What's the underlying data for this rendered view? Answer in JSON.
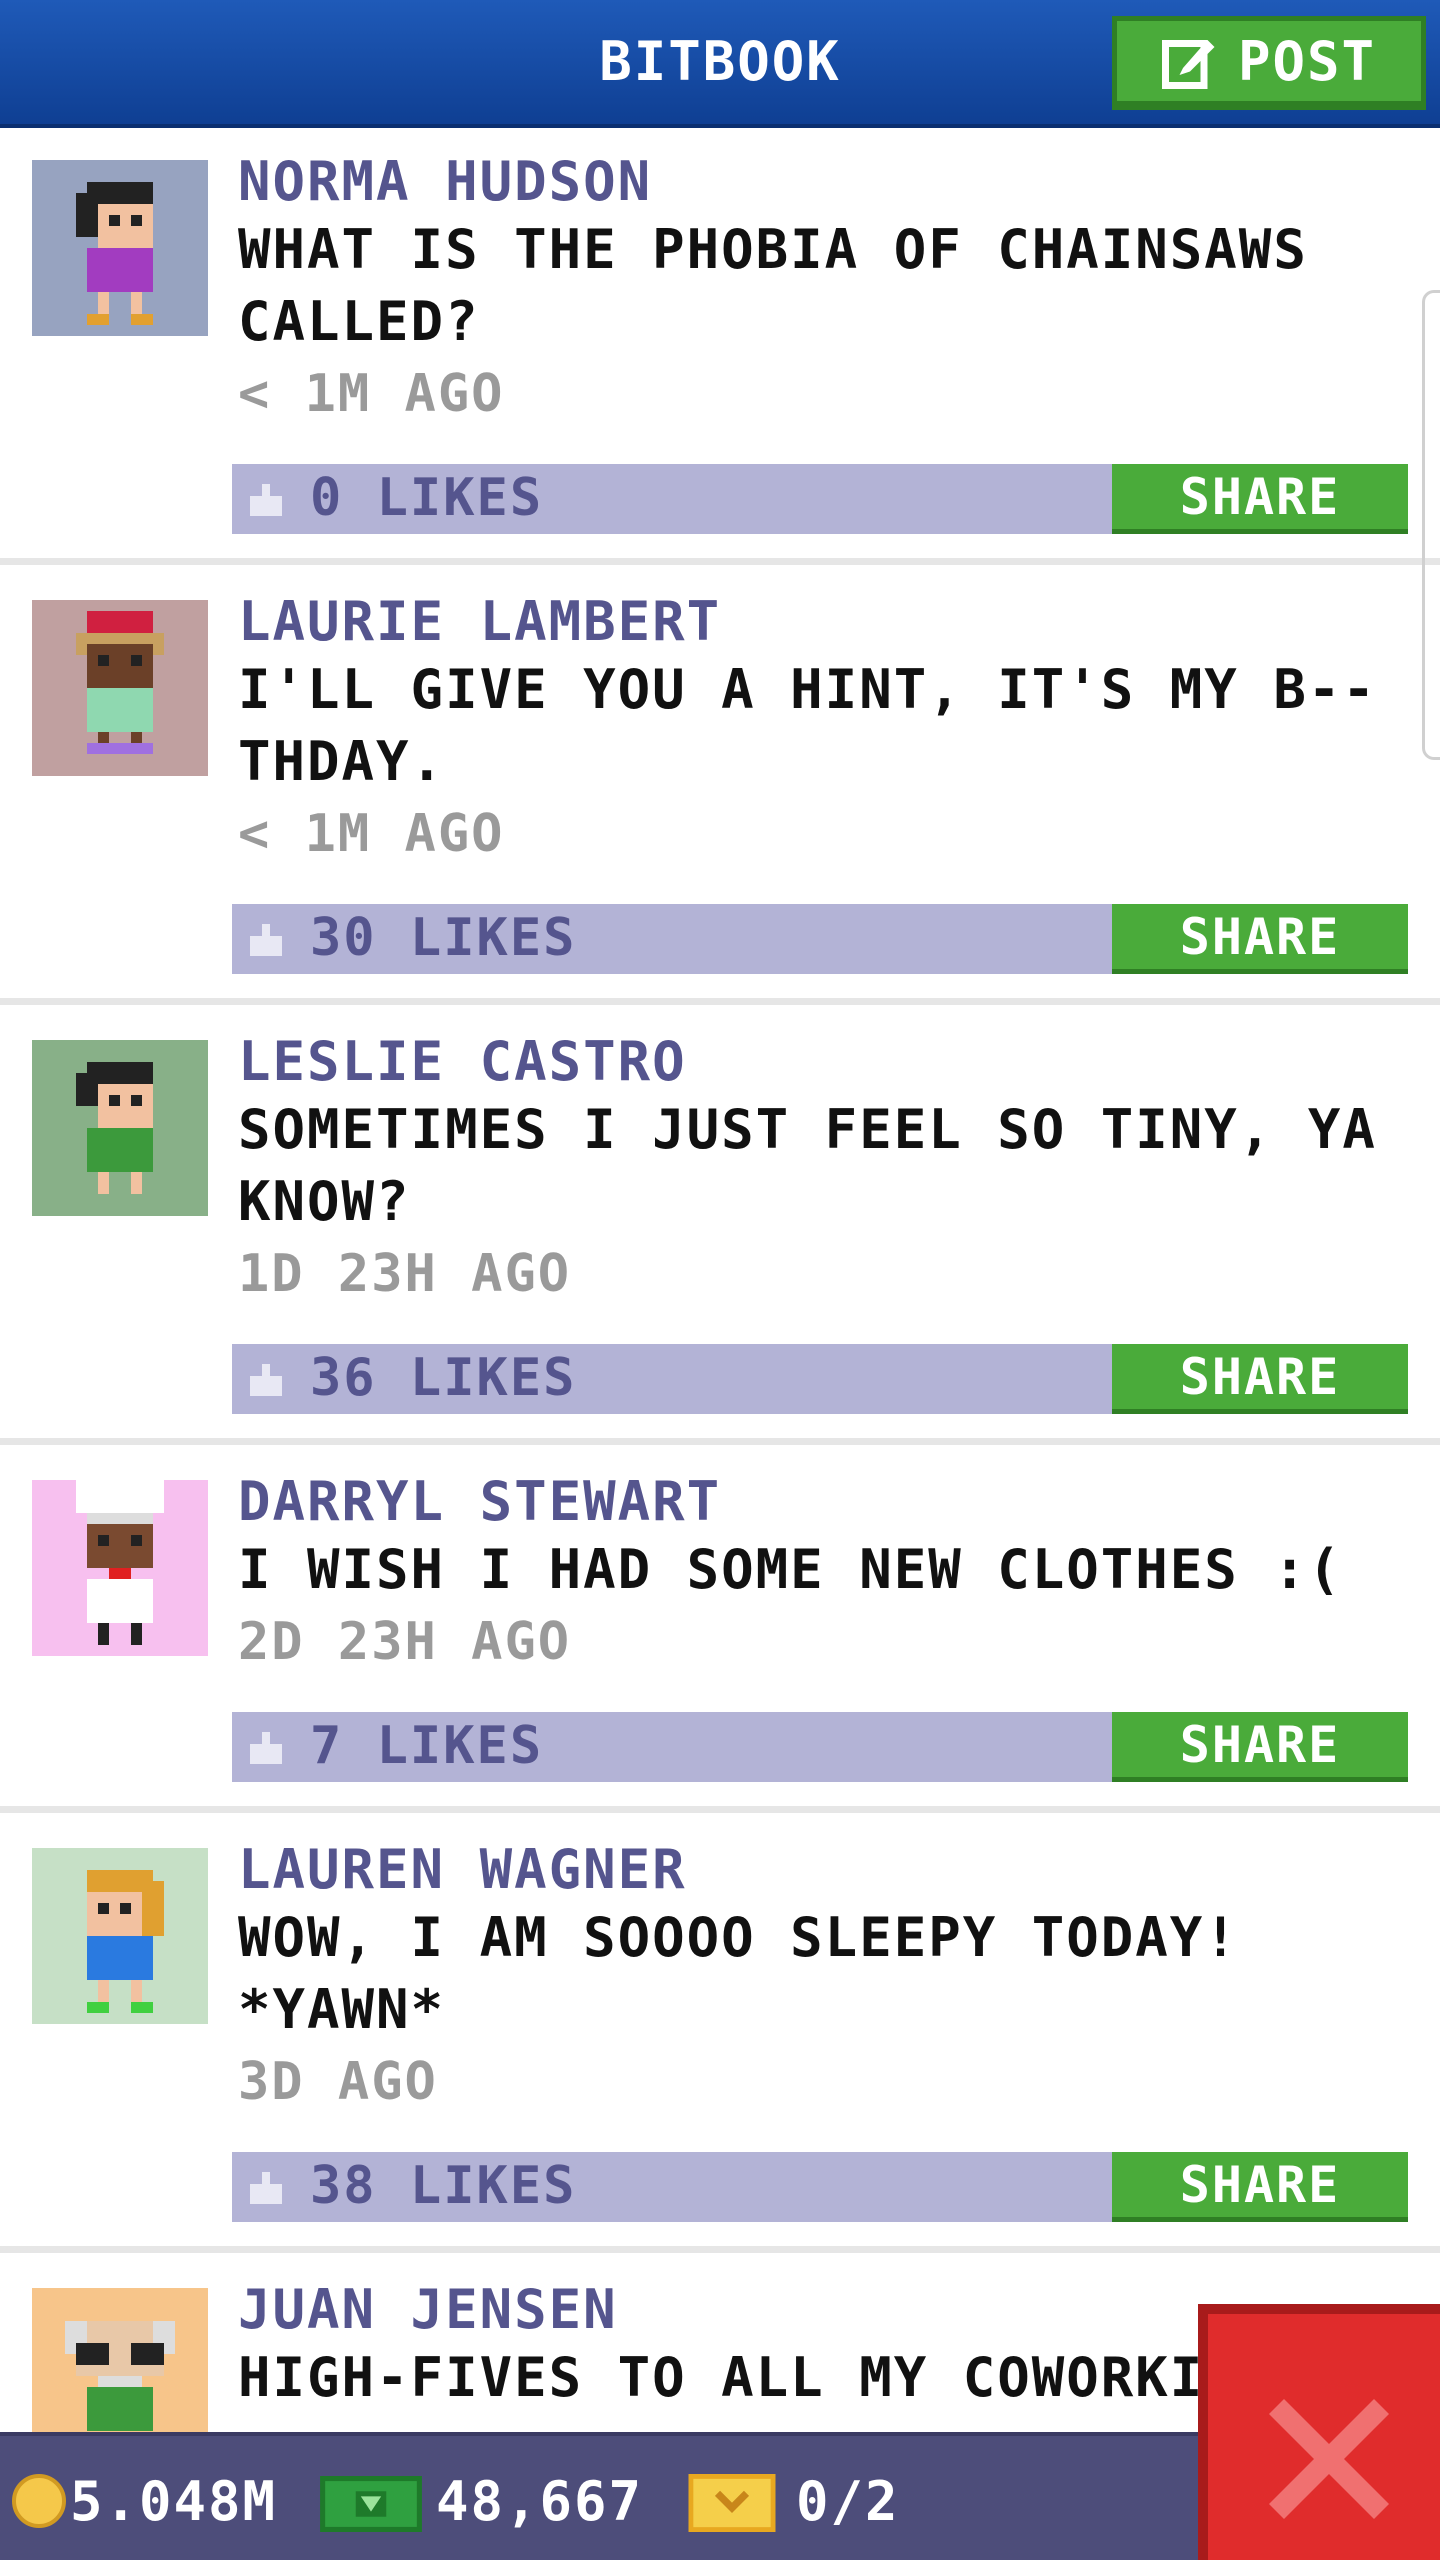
{
  "header": {
    "title": "BITBOOK",
    "post_label": "POST"
  },
  "posts": [
    {
      "author": "NORMA HUDSON",
      "message": "WHAT IS THE PHOBIA OF CHAINSAWS CALLED?",
      "time": "< 1M AGO",
      "likes": "0 LIKES",
      "share_label": "SHARE",
      "avatar_bg": "#97a3c0"
    },
    {
      "author": "LAURIE LAMBERT",
      "message": "I'LL GIVE YOU A HINT, IT'S MY B--THDAY.",
      "time": "< 1M AGO",
      "likes": "30 LIKES",
      "share_label": "SHARE",
      "avatar_bg": "#c0a0a0"
    },
    {
      "author": "LESLIE CASTRO",
      "message": "SOMETIMES I JUST FEEL SO TINY, YA KNOW?",
      "time": "1D 23H AGO",
      "likes": "36 LIKES",
      "share_label": "SHARE",
      "avatar_bg": "#88b088"
    },
    {
      "author": "DARRYL STEWART",
      "message": "I WISH I HAD SOME NEW CLOTHES :(",
      "time": "2D 23H AGO",
      "likes": "7 LIKES",
      "share_label": "SHARE",
      "avatar_bg": "#f7c0ef"
    },
    {
      "author": "LAUREN WAGNER",
      "message": "WOW, I AM SOOOO SLEEPY TODAY! *YAWN*",
      "time": "3D AGO",
      "likes": "38 LIKES",
      "share_label": "SHARE",
      "avatar_bg": "#c6e0c6"
    },
    {
      "author": "JUAN JENSEN",
      "message": "HIGH-FIVES TO ALL MY COWORKI",
      "time": "",
      "likes": "",
      "share_label": "",
      "avatar_bg": "#f7c58a"
    }
  ],
  "status_bar": {
    "coins": "5.048M",
    "bux": "48,667",
    "tickets": "0/2"
  },
  "colors": {
    "header": "#1f5ab8",
    "share": "#4aab3a",
    "like_bar": "#b3b3d6",
    "bottom_bar": "#4d4d7a",
    "close": "#e02c2c"
  }
}
